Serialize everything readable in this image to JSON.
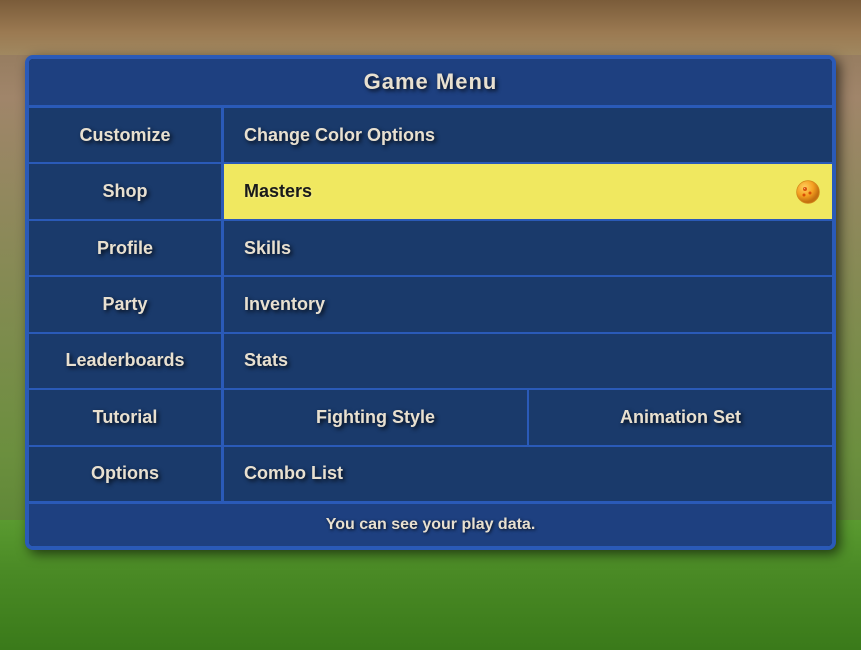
{
  "background": {
    "alt": "Game background with dirt and grass"
  },
  "menu": {
    "title": "Game Menu",
    "nav_items": [
      {
        "id": "customize",
        "label": "Customize"
      },
      {
        "id": "shop",
        "label": "Shop"
      },
      {
        "id": "profile",
        "label": "Profile"
      },
      {
        "id": "party",
        "label": "Party"
      },
      {
        "id": "leaderboards",
        "label": "Leaderboards"
      },
      {
        "id": "tutorial",
        "label": "Tutorial"
      },
      {
        "id": "options",
        "label": "Options"
      }
    ],
    "content_rows": [
      {
        "id": "change-color-options",
        "label": "Change Color Options",
        "type": "single",
        "highlighted": false
      },
      {
        "id": "masters",
        "label": "Masters",
        "type": "single",
        "highlighted": true
      },
      {
        "id": "skills",
        "label": "Skills",
        "type": "single",
        "highlighted": false
      },
      {
        "id": "inventory",
        "label": "Inventory",
        "type": "single",
        "highlighted": false
      },
      {
        "id": "stats",
        "label": "Stats",
        "type": "single",
        "highlighted": false
      },
      {
        "id": "fighting-style-animation",
        "type": "split",
        "cells": [
          {
            "id": "fighting-style",
            "label": "Fighting Style"
          },
          {
            "id": "animation-set",
            "label": "Animation Set"
          }
        ]
      },
      {
        "id": "combo-list",
        "label": "Combo List",
        "type": "single",
        "highlighted": false
      }
    ],
    "footer_text": "You can see your play data."
  }
}
